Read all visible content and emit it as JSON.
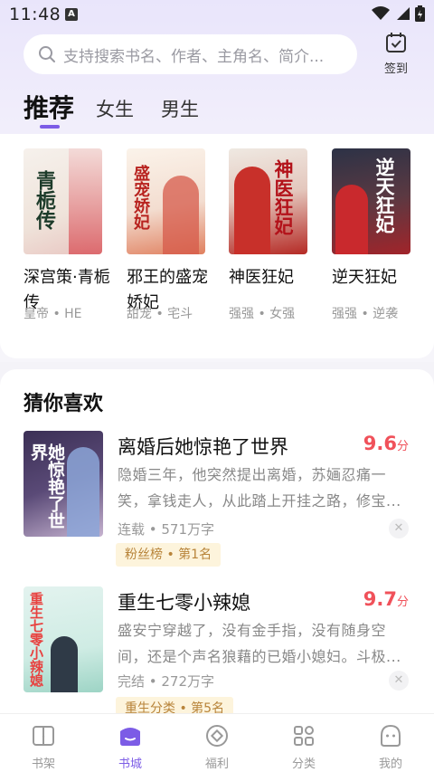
{
  "status": {
    "time": "11:48",
    "notice": "A"
  },
  "search": {
    "placeholder": "支持搜索书名、作者、主角名、简介..."
  },
  "signin": {
    "label": "签到"
  },
  "tabs": [
    {
      "label": "推荐",
      "active": true
    },
    {
      "label": "女生",
      "active": false
    },
    {
      "label": "男生",
      "active": false
    }
  ],
  "recommend": [
    {
      "title": "深宫策·青栀传",
      "tags": "皇帝 • HE",
      "cover_text": "青栀传"
    },
    {
      "title": "邪王的盛宠娇妃",
      "tags": "甜宠 • 宅斗",
      "cover_text": "盛宠娇妃"
    },
    {
      "title": "神医狂妃",
      "tags": "强强 • 女强",
      "cover_text": "神医狂妃"
    },
    {
      "title": "逆天狂妃",
      "tags": "强强 • 逆袭",
      "cover_text": "逆天狂妃"
    }
  ],
  "guess": {
    "title": "猜你喜欢",
    "items": [
      {
        "title": "离婚后她惊艳了世界",
        "score": "9.6",
        "score_unit": "分",
        "desc": "隐婚三年，他突然提出离婚，苏婳忍痛一笑，拿钱走人，从此踏上开挂之路，修宝...",
        "meta": "连载 • 571万字",
        "badge": "粉丝榜 • 第1名",
        "cover_text": "她惊艳了世界"
      },
      {
        "title": "重生七零小辣媳",
        "score": "9.7",
        "score_unit": "分",
        "desc": "盛安宁穿越了，没有金手指，没有随身空间，还是个声名狼藉的已婚小媳妇。斗极...",
        "meta": "完结 • 272万字",
        "badge": "重生分类 • 第5名",
        "cover_text": "重生七零小辣媳"
      }
    ]
  },
  "nav": [
    {
      "label": "书架",
      "icon": "bookshelf-icon",
      "active": false
    },
    {
      "label": "书城",
      "icon": "bookstore-icon",
      "active": true
    },
    {
      "label": "福利",
      "icon": "welfare-icon",
      "active": false
    },
    {
      "label": "分类",
      "icon": "category-icon",
      "active": false
    },
    {
      "label": "我的",
      "icon": "profile-icon",
      "active": false
    }
  ],
  "colors": {
    "accent": "#7c5ce6",
    "score": "#f0515a",
    "badge_bg": "#fdf4dc",
    "badge_text": "#b8843a"
  }
}
